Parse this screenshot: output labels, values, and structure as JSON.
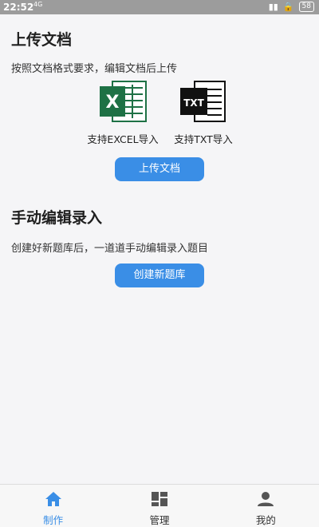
{
  "status": {
    "time": "22:52",
    "network": "4G",
    "battery": "58"
  },
  "upload_section": {
    "title": "上传文档",
    "description": "按照文档格式要求，编辑文档后上传",
    "excel_label": "支持EXCEL导入",
    "txt_label": "支持TXT导入",
    "txt_icon_text": "TXT",
    "upload_button": "上传文档"
  },
  "manual_section": {
    "title": "手动编辑录入",
    "description": "创建好新题库后，一道道手动编辑录入题目",
    "create_button": "创建新题库"
  },
  "tabs": [
    {
      "label": "制作",
      "icon": "home-icon",
      "active": true
    },
    {
      "label": "管理",
      "icon": "dashboard-icon",
      "active": false
    },
    {
      "label": "我的",
      "icon": "person-icon",
      "active": false
    }
  ],
  "colors": {
    "accent": "#3a8ee6",
    "excel_green": "#1e7145",
    "status_bar": "#9c9c9c"
  }
}
